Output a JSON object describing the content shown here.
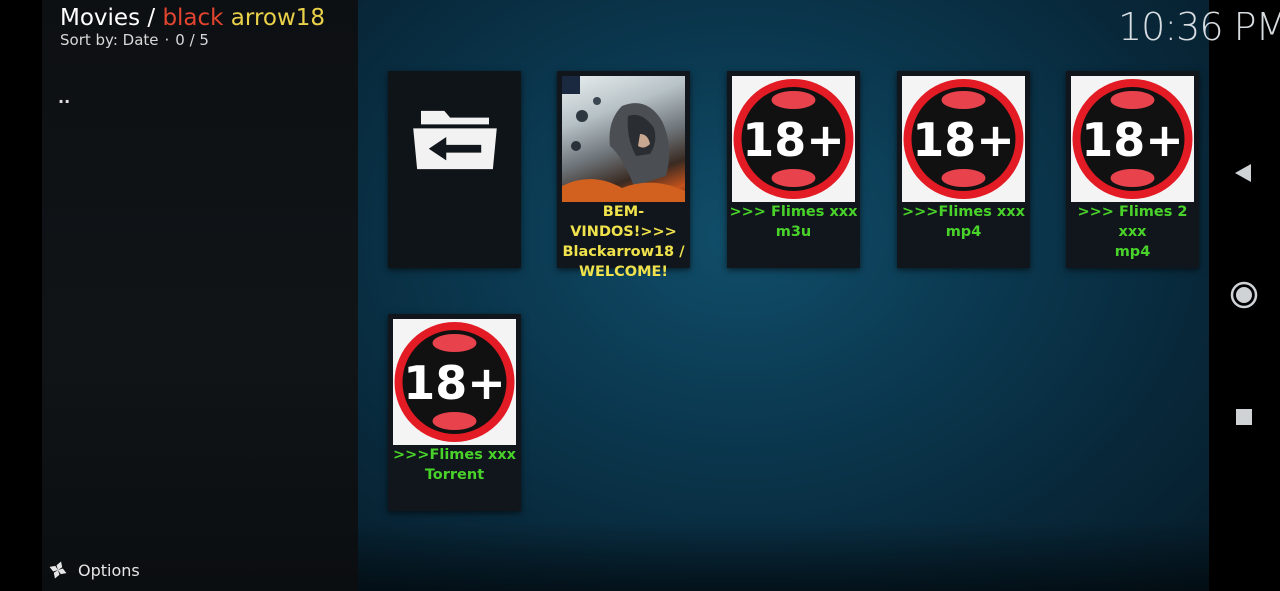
{
  "header": {
    "title_root": "Movies",
    "title_sep": " / ",
    "title_red": "black",
    "title_yellow": " arrow18",
    "sort_label": "Sort by: Date",
    "sort_dot": "·",
    "count": "0 / 5",
    "clock": "10:36 PM"
  },
  "sidebar": {
    "parent_item": "..",
    "options_label": "Options"
  },
  "items": [
    {
      "label": "",
      "icon": "folder-back-icon"
    },
    {
      "label_line1": "BEM-VINDOS!>>>",
      "label_line2": "Blackarrow18  /",
      "label_line3": "WELCOME!",
      "color": "#f0e24c"
    },
    {
      "label_line1": ">>> Flimes xxx",
      "label_line2": "m3u",
      "badge": "18+",
      "color": "#49d22a"
    },
    {
      "label_line1": ">>>Flimes xxx",
      "label_line2": "mp4",
      "badge": "18+",
      "color": "#49d22a"
    },
    {
      "label_line1": ">>> Flimes 2 xxx",
      "label_line2": "mp4",
      "badge": "18+",
      "color": "#49d22a"
    },
    {
      "label_line1": ">>>Flimes xxx",
      "label_line2": "Torrent",
      "badge": "18+",
      "color": "#49d22a"
    }
  ],
  "android_nav": [
    "back-icon",
    "home-icon",
    "recents-icon"
  ]
}
